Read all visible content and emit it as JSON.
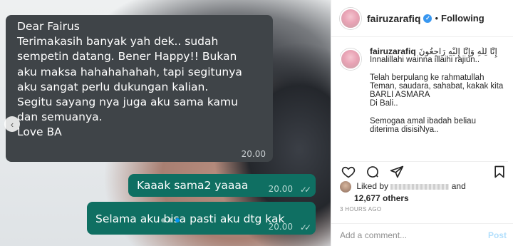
{
  "media": {
    "incoming_message": {
      "lines": [
        "Dear Fairus",
        "Terimakasih banyak yah dek.. sudah",
        "sempetin datang. Bener Happy!! Bukan",
        "aku maksa hahahahahah, tapi segitunya",
        "aku sangat perlu dukungan kalian.",
        "Segitu sayang nya juga aku sama kamu",
        "dan semuanya.",
        "Love BA"
      ],
      "time": "20.00"
    },
    "outgoing_messages": [
      {
        "text": "Kaaak sama2 yaaaa",
        "time": "20.00",
        "ticks": "✓✓"
      },
      {
        "text": "Selama aku bisa pasti aku dtg kak",
        "time": "20.00",
        "ticks": "✓✓"
      }
    ],
    "prev_arrow": "‹",
    "carousel": {
      "count": 3,
      "active": 2
    }
  },
  "header": {
    "username": "fairuzarafiq",
    "verified_mark": "✓",
    "separator": "•",
    "following": "Following"
  },
  "caption": {
    "username": "fairuzarafiq",
    "arabic": "إِنَّا لِلَّهِ وَإِنَّا إِلَيْهِ رَاجِعُونَ",
    "lines": [
      "Innalillahi wainna illaihi rajiun..",
      "",
      "Telah berpulang ke rahmatullah",
      "Teman, saudara, sahabat, kakak kita",
      "BARLI ASMARA",
      "Di Bali..",
      "",
      "Semogaa amal ibadah beliau",
      "diterima disisiNya.."
    ]
  },
  "likes": {
    "prefix": "Liked by",
    "and": "and",
    "others": "12,677 others"
  },
  "time_ago": "3 HOURS AGO",
  "comment": {
    "placeholder": "Add a comment...",
    "post_label": "Post"
  },
  "icons": [
    "heart-icon",
    "comment-icon",
    "share-icon",
    "bookmark-icon",
    "chevron-left-icon"
  ]
}
